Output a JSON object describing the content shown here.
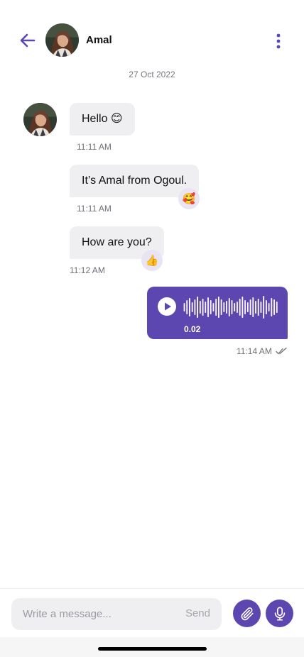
{
  "header": {
    "contact_name": "Amal",
    "back_icon": "arrow-left-icon",
    "more_icon": "more-vertical-icon"
  },
  "date_separator": "27 Oct 2022",
  "messages": [
    {
      "text": "Hello 😊",
      "time": "11:11 AM",
      "reaction": ""
    },
    {
      "text": "It’s Amal from Ogoul.",
      "time": "11:11 AM",
      "reaction": "🥰"
    },
    {
      "text": "How are you?",
      "time": "11:12 AM",
      "reaction": "👍"
    }
  ],
  "voice_message": {
    "duration": "0.02",
    "time": "11:14 AM",
    "status": "read",
    "play_icon": "play-icon"
  },
  "composer": {
    "placeholder": "Write a message...",
    "send_label": "Send",
    "attach_icon": "paperclip-icon",
    "mic_icon": "microphone-icon"
  },
  "colors": {
    "accent": "#5c46b0",
    "incoming_bubble": "#efeff1",
    "reaction_bg": "#e9e4f4"
  }
}
